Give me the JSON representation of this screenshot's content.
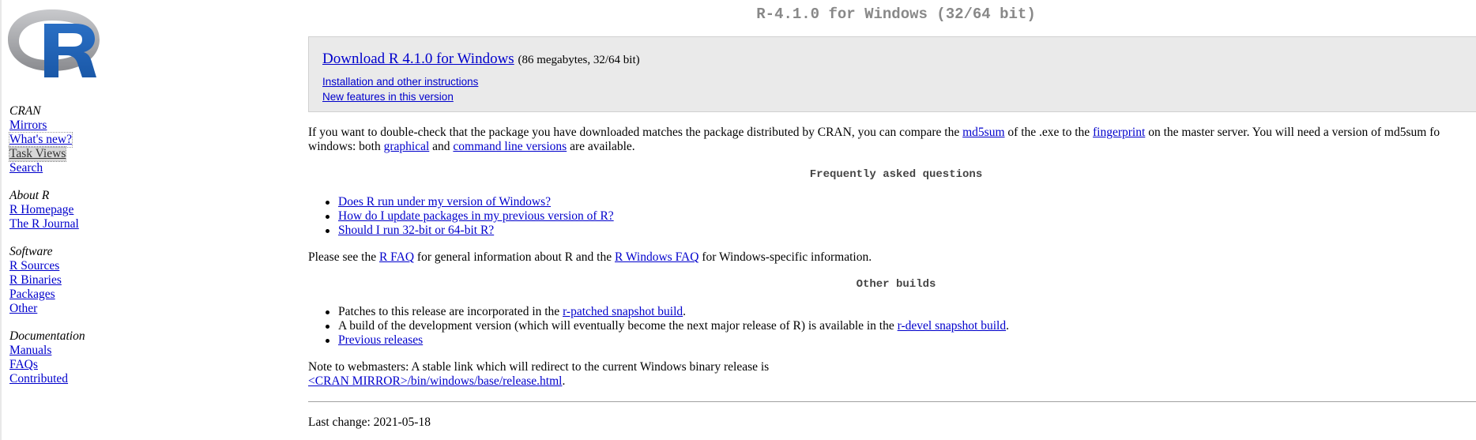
{
  "title": "R-4.1.0 for Windows (32/64 bit)",
  "sidebar": {
    "sections": [
      {
        "heading": "CRAN",
        "links": [
          "Mirrors",
          "What's new?",
          "Task Views",
          "Search"
        ]
      },
      {
        "heading": "About R",
        "links": [
          "R Homepage",
          "The R Journal"
        ]
      },
      {
        "heading": "Software",
        "links": [
          "R Sources",
          "R Binaries",
          "Packages",
          "Other"
        ]
      },
      {
        "heading": "Documentation",
        "links": [
          "Manuals",
          "FAQs",
          "Contributed"
        ]
      }
    ]
  },
  "download": {
    "link": "Download R 4.1.0 for Windows",
    "size": "(86 megabytes, 32/64 bit)",
    "install_link": "Installation and other instructions",
    "features_link": "New features in this version"
  },
  "checksum": {
    "text1": "If you want to double-check that the package you have downloaded matches the package distributed by CRAN, you can compare the ",
    "md5sum_link": "md5sum",
    "text2": " of the .exe to the ",
    "fingerprint_link": "fingerprint",
    "text3": " on the master server. You will need a version of md5sum fo",
    "text4": "windows: both ",
    "graphical_link": "graphical",
    "text5": " and ",
    "cmdline_link": "command line versions",
    "text6": " are available."
  },
  "faq": {
    "heading": "Frequently asked questions",
    "items": [
      "Does R run under my version of Windows?",
      "How do I update packages in my previous version of R?",
      "Should I run 32-bit or 64-bit R?"
    ]
  },
  "faq_note": {
    "text1": "Please see the ",
    "rfaq_link": "R FAQ",
    "text2": " for general information about R and the ",
    "winfaq_link": "R Windows FAQ",
    "text3": " for Windows-specific information."
  },
  "other_builds": {
    "heading": "Other builds",
    "patched_text": "Patches to this release are incorporated in the ",
    "patched_link": "r-patched snapshot build",
    "patched_end": ".",
    "devel_text": "A build of the development version (which will eventually become the next major release of R) is available in the ",
    "devel_link": "r-devel snapshot build",
    "devel_end": ".",
    "previous_link": "Previous releases"
  },
  "webmasters": {
    "text": "Note to webmasters: A stable link which will redirect to the current Windows binary release is",
    "link": "<CRAN MIRROR>/bin/windows/base/release.html",
    "end": "."
  },
  "last_change": "Last change: 2021-05-18"
}
